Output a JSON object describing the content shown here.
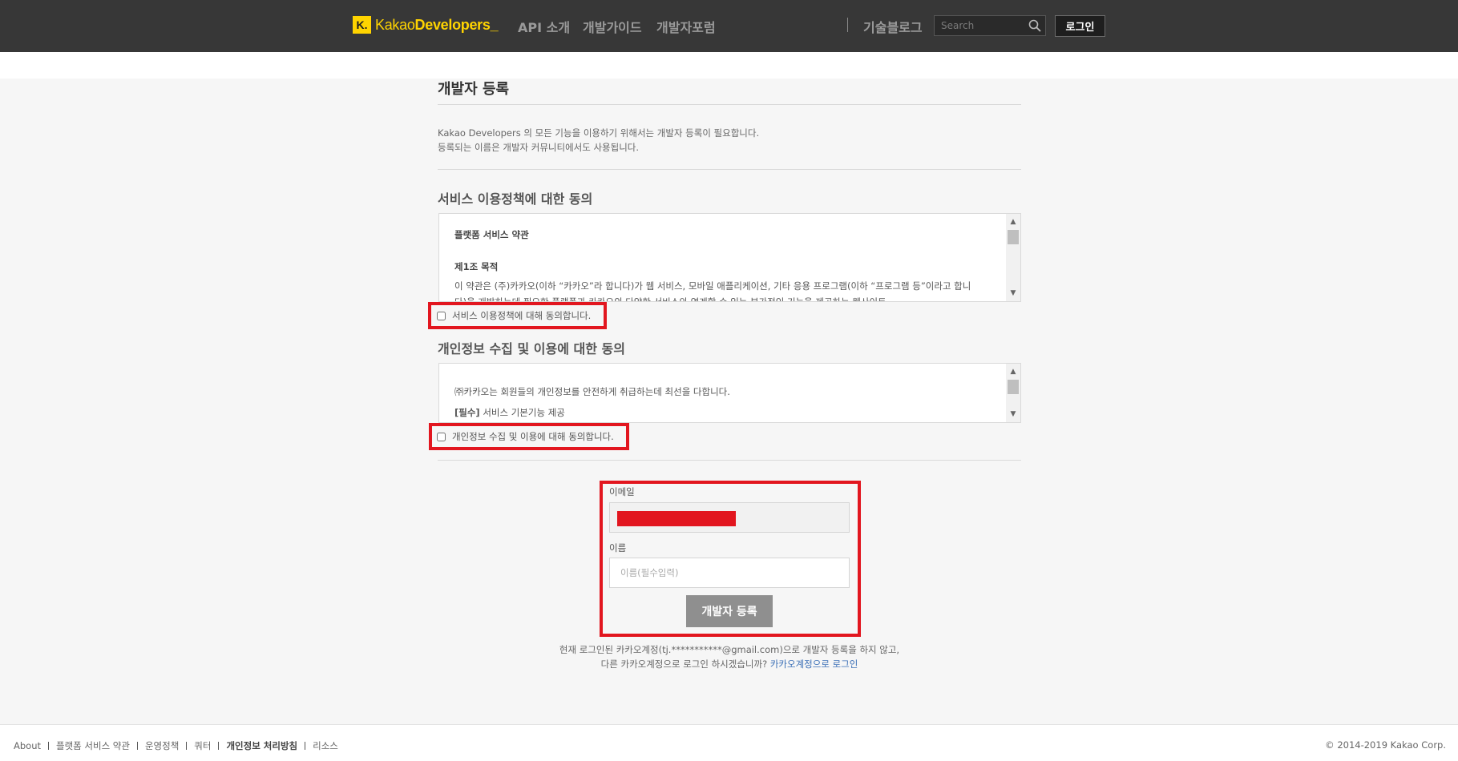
{
  "header": {
    "logo_mark": "K.",
    "logo_text_1": "Kakao",
    "logo_text_2": "Developers",
    "logo_text_3": "_",
    "nav": [
      "API 소개",
      "개발가이드",
      "개발자포럼"
    ],
    "tech_blog": "기술블로그",
    "search_placeholder": "Search",
    "login_label": "로그인"
  },
  "page": {
    "title": "개발자 등록",
    "intro_line1": "Kakao Developers 의 모든 기능을 이용하기 위해서는 개발자 등록이 필요합니다.",
    "intro_line2": "등록되는 이름은 개발자 커뮤니티에서도 사용됩니다."
  },
  "service_terms": {
    "section_title": "서비스 이용정책에 대한 동의",
    "heading": "플랫폼 서비스 약관",
    "article_title": "제1조 목적",
    "article_body": "이 약관은 (주)카카오(이하 “카카오”라 합니다)가 웹 서비스, 모바일 애플리케이션, 기타 응용 프로그램(이하 “프로그램 등”이라고 합니다)을 개발하는데 필요한 플랫폼과 카카오의 다양한 서비스와 연계할 수 있는 부가적인 기능을 제공하는 웹사이트",
    "agree_label": "서비스 이용정책에 대해 동의합니다."
  },
  "privacy_terms": {
    "section_title": "개인정보 수집 및 이용에 대한 동의",
    "line1": "㈜카카오는 회원들의 개인정보를 안전하게 취급하는데 최선을 다합니다.",
    "line2_bold": "[필수]",
    "line2_rest": " 서비스 기본기능 제공",
    "agree_label": "개인정보 수집 및 이용에 대해 동의합니다."
  },
  "form": {
    "email_label": "이메일",
    "name_label": "이름",
    "name_placeholder": "이름(필수입력)",
    "submit_label": "개발자 등록"
  },
  "note": {
    "line1": "현재 로그인된 카카오계정(tj.***********@gmail.com)으로 개발자 등록을 하지 않고,",
    "line2": "다른 카카오계정으로 로그인 하시겠습니까? ",
    "link": "카카오계정으로 로그인"
  },
  "footer": {
    "links": [
      "About",
      "플랫폼 서비스 약관",
      "운영정책",
      "쿼터",
      "개인정보 처리방침",
      "리소스"
    ],
    "copyright": "© 2014-2019 Kakao Corp."
  },
  "colors": {
    "header_bg": "#373737",
    "brand_yellow": "#ffd400",
    "highlight_red": "#e2161f",
    "link_blue": "#3b6fb6"
  }
}
